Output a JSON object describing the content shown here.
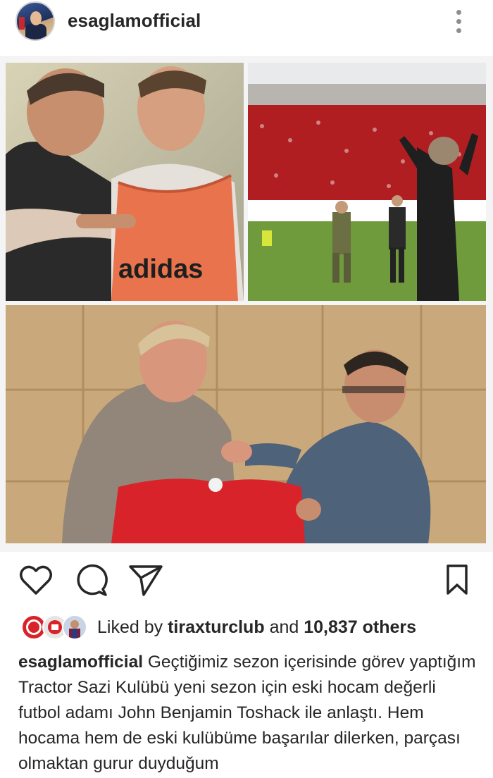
{
  "post": {
    "username": "esaglamofficial",
    "more_icon": "more-vertical-icon",
    "images": [
      {
        "label": "adidas"
      },
      {},
      {}
    ],
    "actions": {
      "like_icon": "heart-icon",
      "comment_icon": "comment-icon",
      "share_icon": "send-icon",
      "save_icon": "bookmark-icon"
    },
    "likes": {
      "prefix": "Liked by",
      "first_user": "tiraxturclub",
      "middle": "and",
      "others": "10,837 others"
    },
    "caption": {
      "author": "esaglamofficial",
      "text": "Geçtiğimiz sezon içerisinde görev yaptığım Tractor Sazi Kulübü yeni sezon için eski hocam değerli futbol adamı John Benjamin Toshack ile anlaştı. Hem hocama hem de eski kulübüme başarılar dilerken, parçası olmaktan gurur duyduğum"
    }
  },
  "colors": {
    "text": "#262626",
    "secondary": "#8e8e8e",
    "divider": "#efefef",
    "club_red": "#d9232a"
  }
}
